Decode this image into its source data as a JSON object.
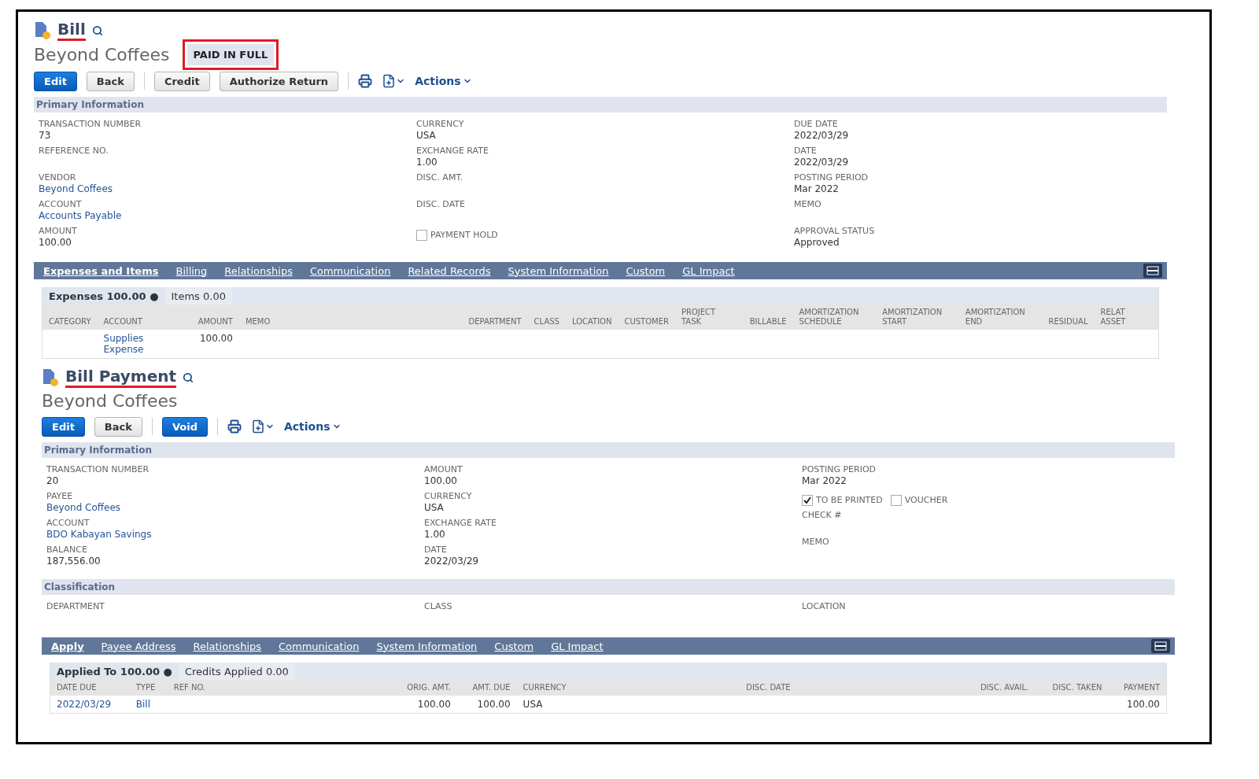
{
  "bill": {
    "title": "Bill",
    "name": "Beyond Coffees",
    "status": "PAID IN FULL",
    "buttons": [
      {
        "label": "Edit",
        "kind": "primary"
      },
      {
        "label": "Back",
        "kind": "secondary"
      },
      {
        "kind": "divider"
      },
      {
        "label": "Credit",
        "kind": "secondary"
      },
      {
        "label": "Authorize Return",
        "kind": "secondary"
      },
      {
        "kind": "divider"
      }
    ],
    "actions": "Actions",
    "sections": [
      {
        "heading": "Primary Information",
        "columns": [
          [
            {
              "kind": "field",
              "label": "TRANSACTION NUMBER",
              "value": "73"
            },
            {
              "kind": "field",
              "label": "REFERENCE NO."
            },
            {
              "kind": "field",
              "label": "VENDOR",
              "value": "Beyond Coffees",
              "link": true
            },
            {
              "kind": "field",
              "label": "ACCOUNT",
              "value": "Accounts Payable",
              "link": true
            },
            {
              "kind": "field",
              "label": "AMOUNT",
              "value": "100.00"
            }
          ],
          [
            {
              "kind": "field",
              "label": "CURRENCY",
              "value": "USA"
            },
            {
              "kind": "field",
              "label": "EXCHANGE RATE",
              "value": "1.00"
            },
            {
              "kind": "field",
              "label": "DISC. AMT."
            },
            {
              "kind": "field",
              "label": "DISC. DATE"
            },
            {
              "kind": "checkboxes",
              "items": [
                {
                  "label": "PAYMENT HOLD",
                  "checked": false
                }
              ]
            }
          ],
          [
            {
              "kind": "field",
              "label": "DUE DATE",
              "value": "2022/03/29"
            },
            {
              "kind": "field",
              "label": "DATE",
              "value": "2022/03/29"
            },
            {
              "kind": "field",
              "label": "POSTING PERIOD",
              "value": "Mar 2022"
            },
            {
              "kind": "field",
              "label": "MEMO"
            },
            {
              "kind": "field",
              "label": "APPROVAL STATUS",
              "value": "Approved"
            }
          ]
        ]
      }
    ],
    "tabs": [
      {
        "label": "Expenses and Items",
        "selected": true
      },
      {
        "label": "Billing",
        "selected": false
      },
      {
        "label": "Relationships",
        "selected": false
      },
      {
        "label": "Communication",
        "selected": false
      },
      {
        "label": "Related Records",
        "selected": false
      },
      {
        "label": "System Information",
        "selected": false
      },
      {
        "label": "Custom",
        "selected": false
      },
      {
        "label": "GL Impact",
        "selected": false
      }
    ],
    "subtabs": [
      {
        "label": "Expenses 100.00 ●",
        "selected": true
      },
      {
        "label": "Items 0.00",
        "selected": false
      }
    ],
    "table": {
      "columns": [
        {
          "label": "CATEGORY"
        },
        {
          "label": "ACCOUNT"
        },
        {
          "label": "AMOUNT",
          "numeric": true
        },
        {
          "label": "MEMO",
          "wide": true
        },
        {
          "label": "DEPARTMENT"
        },
        {
          "label": "CLASS"
        },
        {
          "label": "LOCATION"
        },
        {
          "label": "CUSTOMER"
        },
        {
          "label": "PROJECT TASK"
        },
        {
          "label": "BILLABLE"
        },
        {
          "label": "AMORTIZATION SCHEDULE"
        },
        {
          "label": "AMORTIZATION START"
        },
        {
          "label": "AMORTIZATION END"
        },
        {
          "label": "RESIDUAL",
          "numeric": true
        },
        {
          "label": "RELAT ASSET"
        }
      ],
      "rows": [
        [
          null,
          {
            "text": "Supplies Expense",
            "link": true
          },
          {
            "text": "100.00"
          },
          null,
          null,
          null,
          null,
          null,
          null,
          null,
          null,
          null,
          null,
          null,
          null
        ]
      ]
    }
  },
  "bill_payment": {
    "title": "Bill Payment",
    "name": "Beyond Coffees",
    "buttons": [
      {
        "label": "Edit",
        "kind": "primary"
      },
      {
        "label": "Back",
        "kind": "secondary"
      },
      {
        "kind": "divider"
      },
      {
        "label": "Void",
        "kind": "primary"
      },
      {
        "kind": "divider"
      }
    ],
    "actions": "Actions",
    "sections": [
      {
        "heading": "Primary Information",
        "columns": [
          [
            {
              "kind": "field",
              "label": "TRANSACTION NUMBER",
              "value": "20"
            },
            {
              "kind": "field",
              "label": "PAYEE",
              "value": "Beyond Coffees",
              "link": true
            },
            {
              "kind": "field",
              "label": "ACCOUNT",
              "value": "BDO Kabayan Savings",
              "link": true
            },
            {
              "kind": "field",
              "label": "BALANCE",
              "value": "187,556.00"
            }
          ],
          [
            {
              "kind": "field",
              "label": "AMOUNT",
              "value": "100.00"
            },
            {
              "kind": "field",
              "label": "CURRENCY",
              "value": "USA"
            },
            {
              "kind": "field",
              "label": "EXCHANGE RATE",
              "value": "1.00"
            },
            {
              "kind": "field",
              "label": "DATE",
              "value": "2022/03/29"
            }
          ],
          [
            {
              "kind": "field",
              "label": "POSTING PERIOD",
              "value": "Mar 2022"
            },
            {
              "kind": "checkboxes",
              "items": [
                {
                  "label": "TO BE PRINTED",
                  "checked": true
                },
                {
                  "label": "VOUCHER",
                  "checked": false
                }
              ]
            },
            {
              "kind": "field",
              "label": "CHECK #"
            },
            {
              "kind": "field",
              "label": "MEMO"
            }
          ]
        ]
      },
      {
        "heading": "Classification",
        "columns": [
          [
            {
              "kind": "field",
              "label": "DEPARTMENT"
            }
          ],
          [
            {
              "kind": "field",
              "label": "CLASS"
            }
          ],
          [
            {
              "kind": "field",
              "label": "LOCATION"
            }
          ]
        ]
      }
    ],
    "tabs": [
      {
        "label": "Apply",
        "selected": true
      },
      {
        "label": "Payee Address",
        "selected": false
      },
      {
        "label": "Relationships",
        "selected": false
      },
      {
        "label": "Communication",
        "selected": false
      },
      {
        "label": "System Information",
        "selected": false
      },
      {
        "label": "Custom",
        "selected": false
      },
      {
        "label": "GL Impact",
        "selected": false
      }
    ],
    "subtabs": [
      {
        "label": "Applied To 100.00 ●",
        "selected": true
      },
      {
        "label": "Credits Applied 0.00",
        "selected": false
      }
    ],
    "table": {
      "columns": [
        {
          "label": "DATE DUE"
        },
        {
          "label": "TYPE"
        },
        {
          "label": "REF NO.",
          "wide": true
        },
        {
          "label": "ORIG. AMT.",
          "numeric": true
        },
        {
          "label": "AMT. DUE",
          "numeric": true
        },
        {
          "label": "CURRENCY",
          "wide": true
        },
        {
          "label": "DISC. DATE",
          "wide": true
        },
        {
          "label": "DISC. AVAIL.",
          "numeric": true
        },
        {
          "label": "DISC. TAKEN",
          "numeric": true
        },
        {
          "label": "PAYMENT",
          "numeric": true
        }
      ],
      "rows": [
        [
          {
            "text": "2022/03/29",
            "link": true
          },
          {
            "text": "Bill",
            "link": true
          },
          null,
          {
            "text": "100.00"
          },
          {
            "text": "100.00"
          },
          {
            "text": "USA"
          },
          null,
          null,
          null,
          {
            "text": "100.00"
          }
        ]
      ]
    }
  }
}
